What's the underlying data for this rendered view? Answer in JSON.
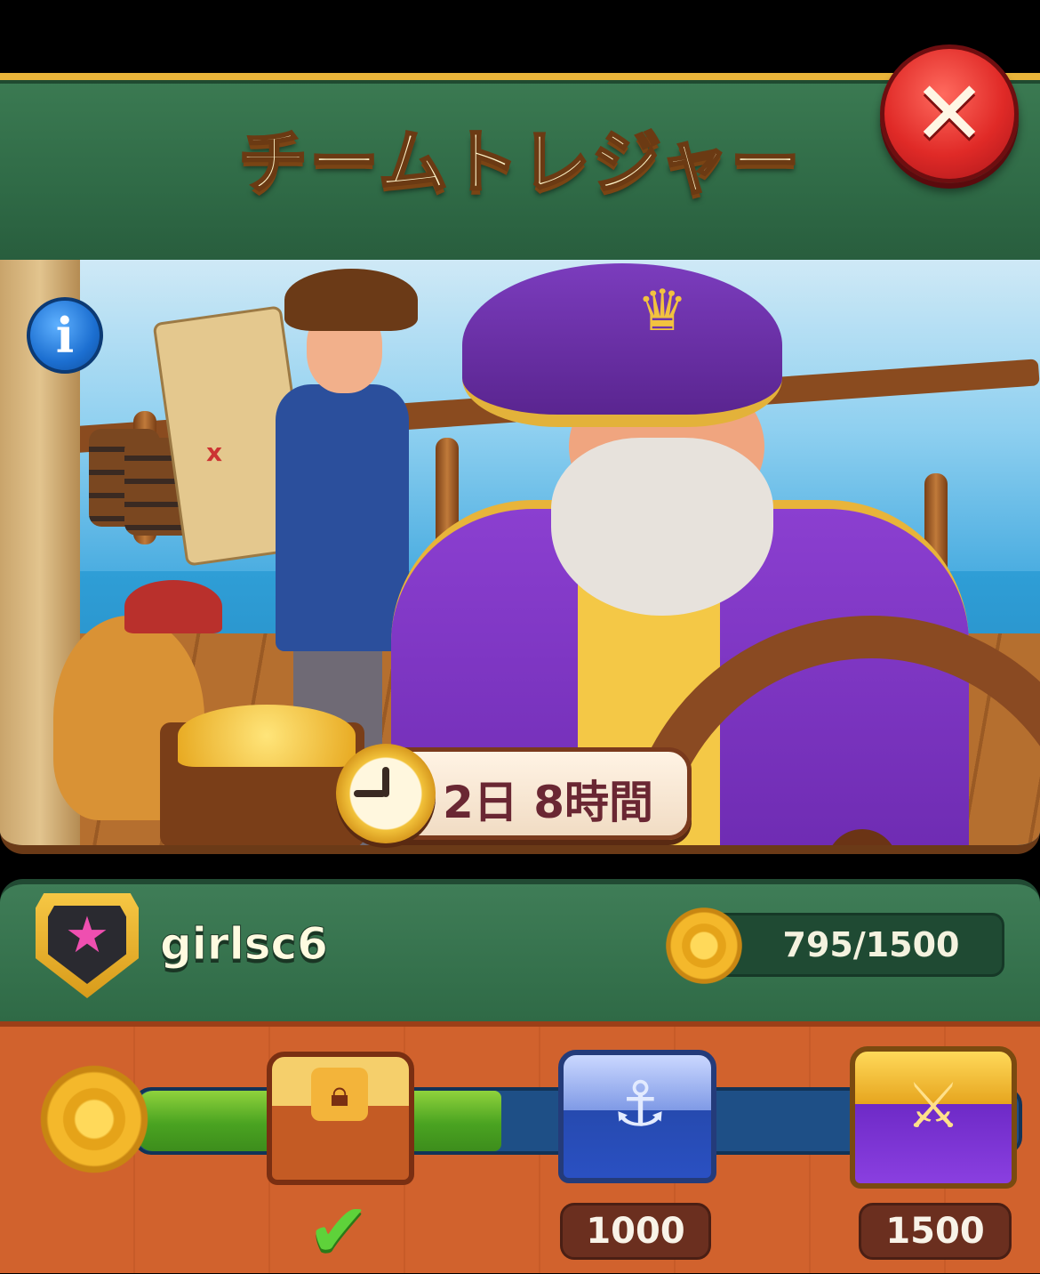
{
  "header": {
    "title": "チームトレジャー",
    "close_icon": "close-icon"
  },
  "scene": {
    "info_label": "i",
    "timer_text": "2日 8時間",
    "timer_icon": "clock-icon"
  },
  "player": {
    "username": "girlsc6",
    "badge_icon": "star-shield-icon",
    "score": "795/1500",
    "score_icon": "ship-wheel-icon"
  },
  "progress": {
    "current": 795,
    "max": 1500,
    "start_icon": "ship-wheel-icon",
    "milestones": [
      {
        "icon": "wooden-chest-icon",
        "label": "",
        "claimed": true
      },
      {
        "icon": "blue-anchor-chest-icon",
        "label": "1000",
        "claimed": false
      },
      {
        "icon": "purple-swords-chest-icon",
        "label": "1500",
        "claimed": false
      }
    ]
  },
  "colors": {
    "banner_green": "#2f6a46",
    "gold": "#e9b43a",
    "close_red": "#e02a27",
    "progress_green": "#4aa321",
    "track_blue": "#1e4f86",
    "wood_orange": "#d1622d"
  }
}
